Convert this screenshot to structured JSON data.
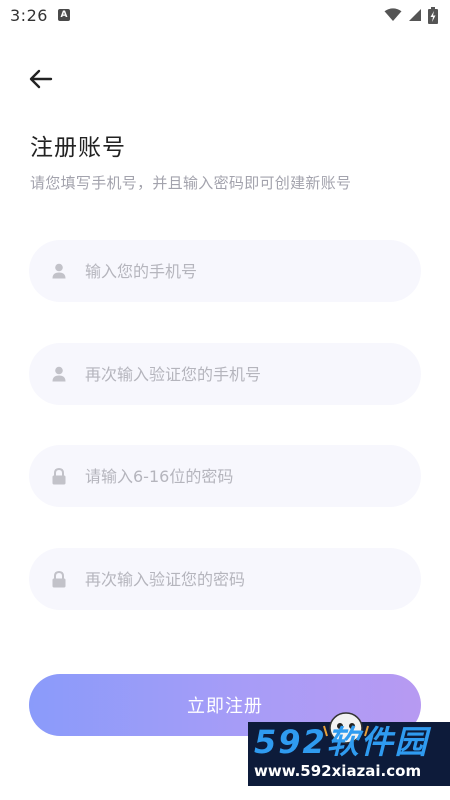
{
  "status_bar": {
    "time": "3:26",
    "notification_icon": "a-notification-icon",
    "wifi_icon": "wifi-icon",
    "signal_icon": "cell-signal-icon",
    "battery_icon": "battery-charging-icon"
  },
  "header": {
    "back_icon": "arrow-left-icon",
    "title": "注册账号",
    "subtitle": "请您填写手机号，并且输入密码即可创建新账号"
  },
  "form": {
    "phone": {
      "icon": "user-icon",
      "placeholder": "输入您的手机号",
      "value": ""
    },
    "phone_confirm": {
      "icon": "user-icon",
      "placeholder": "再次输入验证您的手机号",
      "value": ""
    },
    "password": {
      "icon": "lock-icon",
      "placeholder": "请输入6-16位的密码",
      "value": ""
    },
    "password_confirm": {
      "icon": "lock-icon",
      "placeholder": "再次输入验证您的密码",
      "value": ""
    },
    "submit_label": "立即注册"
  },
  "watermark": {
    "brand": "592软件园",
    "url": "www.592xiazai.com"
  },
  "colors": {
    "field_bg": "#f7f7fd",
    "placeholder": "#b5b5bd",
    "button_gradient_start": "#8a9bfa",
    "button_gradient_end": "#b79af2",
    "subtitle": "#a3a3ad"
  }
}
